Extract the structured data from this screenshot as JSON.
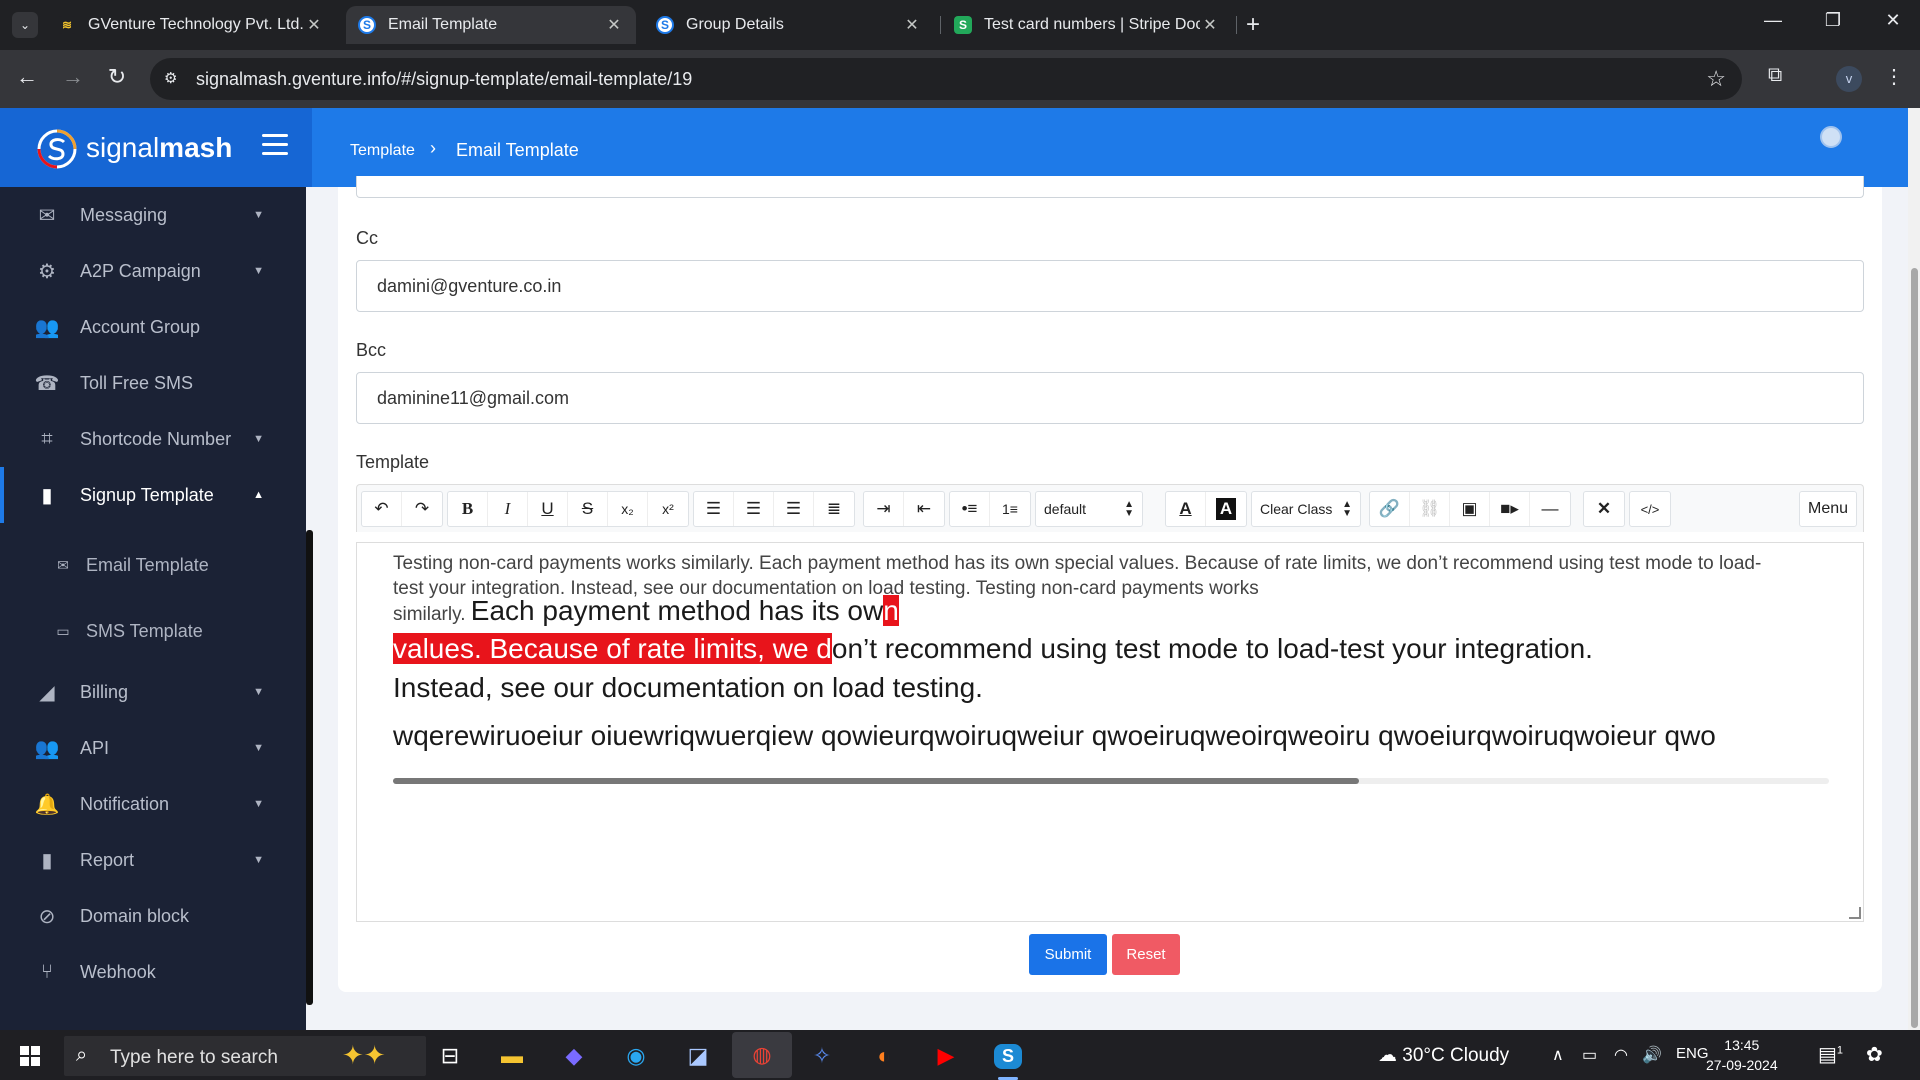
{
  "browser": {
    "tabs": [
      {
        "title": "GVenture Technology Pvt. Ltd. -",
        "active": false
      },
      {
        "title": "Email Template",
        "active": true
      },
      {
        "title": "Group Details",
        "active": false
      },
      {
        "title": "Test card numbers | Stripe Docu",
        "active": false
      }
    ],
    "url": "signalmash.gventure.info/#/signup-template/email-template/19",
    "profile_initial": "v"
  },
  "header": {
    "logo_plain": "signal",
    "logo_bold": "mash",
    "breadcrumb_root": "Template",
    "breadcrumb_current": "Email Template"
  },
  "sidebar": {
    "items": [
      {
        "label": "Messaging",
        "icon": "envelope-icon"
      },
      {
        "label": "A2P Campaign",
        "icon": "gear-icon"
      },
      {
        "label": "Account Group",
        "icon": "users-icon"
      },
      {
        "label": "Toll Free SMS",
        "icon": "phone-icon"
      },
      {
        "label": "Shortcode Number",
        "icon": "code-file-icon"
      },
      {
        "label": "Signup Template",
        "icon": "file-icon"
      },
      {
        "label": "Billing",
        "icon": "wifi-icon"
      },
      {
        "label": "API",
        "icon": "users-icon"
      },
      {
        "label": "Notification",
        "icon": "bell-icon"
      },
      {
        "label": "Report",
        "icon": "file-icon"
      },
      {
        "label": "Domain block",
        "icon": "ban-icon"
      },
      {
        "label": "Webhook",
        "icon": "branch-icon"
      }
    ],
    "sub_items": [
      {
        "label": "Email Template"
      },
      {
        "label": "SMS Template"
      }
    ]
  },
  "form": {
    "cc_label": "Cc",
    "cc_value": "damini@gventure.co.in",
    "bcc_label": "Bcc",
    "bcc_value": "daminine11@gmail.com",
    "template_label": "Template"
  },
  "editor": {
    "font_select": "default",
    "class_select": "Clear Class",
    "menu_label": "Menu",
    "line1": "Testing non-card payments works similarly. Each payment method has its own special values. Because of rate limits, we don’t recommend using test mode to load-",
    "line2": "test your integration.   Instead, see our documentation on load testing. Testing non-card payments works",
    "line3_small": "similarly. ",
    "line3_big": "Each payment method has its ow",
    "line3_hl": "n",
    "line4_hl": "values. Because of rate limits, we d",
    "line4_rest": "on’t  recommend  using test mode to load-test your integration.",
    "line5": " Instead, see our documentation on load testing.",
    "line6": "wqerewiruoeiur oiuewriqwuerqiew qowieurqwoiruqweiur qwoeiruqweoirqweoiru qwoeiurqwoiruqwoieur qwo"
  },
  "actions": {
    "submit": "Submit",
    "reset": "Reset"
  },
  "taskbar": {
    "search_placeholder": "Type here to search",
    "weather": "30°C  Cloudy",
    "lang": "ENG",
    "time": "13:45",
    "date": "27-09-2024",
    "notif_count": "1"
  },
  "colors": {
    "header_blue": "#1e7ae8",
    "sidebar_bg": "#1b2235",
    "highlight_red": "#e8141b",
    "submit_blue": "#1a73e8",
    "reset_red": "#f05a64"
  }
}
